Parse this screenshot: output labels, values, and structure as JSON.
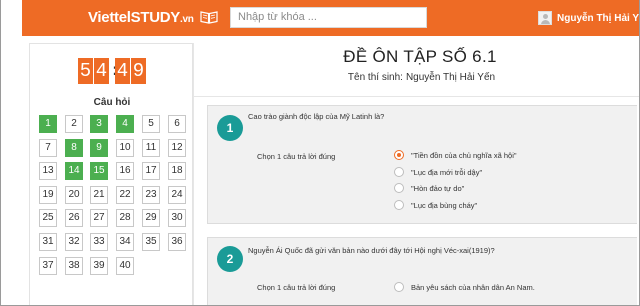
{
  "header": {
    "logo_main": "ViettelSTUDY",
    "logo_suffix": ".vn",
    "search_placeholder": "Nhập từ khóa ...",
    "user_name": "Nguyễn Thị Hải Yến",
    "brand_color": "#ee6b25"
  },
  "timer": {
    "d1": "5",
    "d2": "4",
    "separator": ":",
    "d3": "4",
    "d4": "9"
  },
  "question_panel": {
    "title": "Câu hỏi",
    "cells": [
      {
        "n": "1",
        "done": true
      },
      {
        "n": "2",
        "done": false
      },
      {
        "n": "3",
        "done": true
      },
      {
        "n": "4",
        "done": true
      },
      {
        "n": "5",
        "done": false
      },
      {
        "n": "6",
        "done": false
      },
      {
        "n": "7",
        "done": false
      },
      {
        "n": "8",
        "done": true
      },
      {
        "n": "9",
        "done": true
      },
      {
        "n": "10",
        "done": false
      },
      {
        "n": "11",
        "done": false
      },
      {
        "n": "12",
        "done": false
      },
      {
        "n": "13",
        "done": false
      },
      {
        "n": "14",
        "done": true
      },
      {
        "n": "15",
        "done": true
      },
      {
        "n": "16",
        "done": false
      },
      {
        "n": "17",
        "done": false
      },
      {
        "n": "18",
        "done": false
      },
      {
        "n": "19",
        "done": false
      },
      {
        "n": "20",
        "done": false
      },
      {
        "n": "21",
        "done": false
      },
      {
        "n": "22",
        "done": false
      },
      {
        "n": "23",
        "done": false
      },
      {
        "n": "24",
        "done": false
      },
      {
        "n": "25",
        "done": false
      },
      {
        "n": "26",
        "done": false
      },
      {
        "n": "27",
        "done": false
      },
      {
        "n": "28",
        "done": false
      },
      {
        "n": "29",
        "done": false
      },
      {
        "n": "30",
        "done": false
      },
      {
        "n": "31",
        "done": false
      },
      {
        "n": "32",
        "done": false
      },
      {
        "n": "33",
        "done": false
      },
      {
        "n": "34",
        "done": false
      },
      {
        "n": "35",
        "done": false
      },
      {
        "n": "36",
        "done": false
      },
      {
        "n": "37",
        "done": false
      },
      {
        "n": "38",
        "done": false
      },
      {
        "n": "39",
        "done": false
      },
      {
        "n": "40",
        "done": false
      }
    ]
  },
  "exam": {
    "title": "ĐỀ ÔN TẬP SỐ 6.1",
    "student_label": "Tên thí sinh:",
    "student_name": "Nguyễn Thị Hải Yến"
  },
  "questions": [
    {
      "number": "1",
      "text": "Cao trào giành độc lập của Mỹ Latinh là?",
      "prompt": "Chọn 1 câu trả lời đúng",
      "options": [
        {
          "text": "\"Tiền đồn của chủ nghĩa xã hội\"",
          "selected": true
        },
        {
          "text": "\"Lục địa mới trỗi dậy\"",
          "selected": false
        },
        {
          "text": "\"Hòn đảo tự do\"",
          "selected": false
        },
        {
          "text": "\"Lục địa bùng cháy\"",
          "selected": false
        }
      ]
    },
    {
      "number": "2",
      "text": "Nguyễn Ái Quốc đã gửi văn bản nào dưới đây tới Hội nghị Véc-xai(1919)?",
      "prompt": "Chọn 1 câu trả lời đúng",
      "options": [
        {
          "text": "Bản yêu sách của nhân dân An Nam.",
          "selected": false
        }
      ]
    }
  ]
}
